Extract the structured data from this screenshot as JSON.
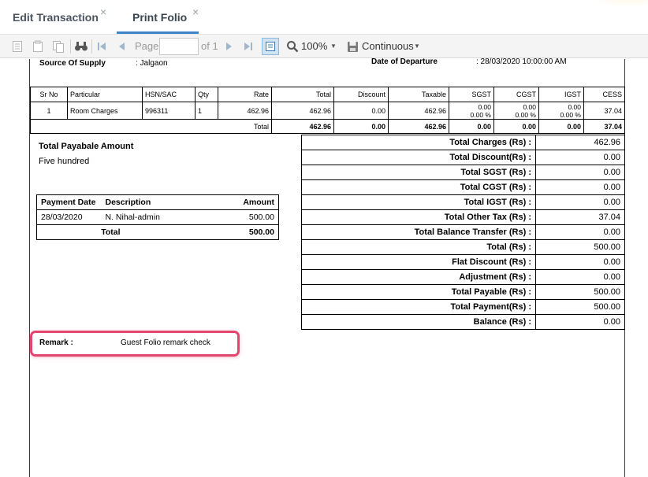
{
  "tabs": [
    {
      "label": "Edit Transaction",
      "close": "×"
    },
    {
      "label": "Print Folio",
      "close": "×"
    }
  ],
  "toolbar": {
    "page_label": "Page",
    "page_value": "",
    "of_label": "of 1",
    "zoom": "100%",
    "view_mode": "Continuous"
  },
  "colors": {
    "active_tab": "#3f84c8",
    "highlight": "#e0466e"
  },
  "report": {
    "source_label": "Source Of Supply",
    "source_value": ": Jalgaon",
    "departure_label": "Date of Departure",
    "departure_value": ":    28/03/2020 10:00:00 AM",
    "items_headers": [
      "Sr No",
      "Particular",
      "HSN/SAC",
      "Qty",
      "Rate",
      "Total",
      "Discount",
      "Taxable",
      "SGST",
      "CGST",
      "IGST",
      "CESS"
    ],
    "items_row": {
      "sr": "1",
      "particular": "Room Charges",
      "hsn": "996311",
      "qty": "1",
      "rate": "462.96",
      "total": "462.96",
      "discount": "0.00",
      "taxable": "462.96",
      "sgst_amt": "0.00",
      "sgst_pct": "0.00 %",
      "cgst_amt": "0.00",
      "cgst_pct": "0.00 %",
      "igst_amt": "0.00",
      "igst_pct": "0.00 %",
      "cess": "37.04"
    },
    "items_total": {
      "label": "Total",
      "total": "462.96",
      "discount": "0.00",
      "taxable": "462.96",
      "sgst": "0.00",
      "cgst": "0.00",
      "igst": "0.00",
      "cess": "37.04"
    },
    "payable_title": "Total Payabale Amount",
    "payable_words": "Five hundred",
    "payments": {
      "headers": [
        "Payment Date",
        "Description",
        "Amount"
      ],
      "rows": [
        {
          "date": "28/03/2020",
          "description": "N. Nihal-admin",
          "amount": "500.00"
        }
      ],
      "total_label": "Total",
      "total_value": "500.00"
    },
    "totals": [
      {
        "label": "Total Charges (Rs) :",
        "value": "462.96"
      },
      {
        "label": "Total Discount(Rs) :",
        "value": "0.00"
      },
      {
        "label": "Total SGST (Rs) :",
        "value": "0.00"
      },
      {
        "label": "Total CGST (Rs) :",
        "value": "0.00"
      },
      {
        "label": "Total IGST (Rs) :",
        "value": "0.00"
      },
      {
        "label": "Total Other Tax (Rs) :",
        "value": "37.04"
      },
      {
        "label": "Total Balance Transfer (Rs) :",
        "value": "0.00"
      },
      {
        "label": "Total (Rs) :",
        "value": "500.00"
      },
      {
        "label": "Flat Discount (Rs) :",
        "value": "0.00"
      },
      {
        "label": "Adjustment (Rs) :",
        "value": "0.00"
      },
      {
        "label": "Total Payable (Rs) :",
        "value": "500.00"
      },
      {
        "label": "Total Payment(Rs) :",
        "value": "500.00"
      },
      {
        "label": "Balance (Rs) :",
        "value": "0.00"
      }
    ],
    "remark_label": "Remark :",
    "remark_value": "Guest Folio remark check"
  }
}
